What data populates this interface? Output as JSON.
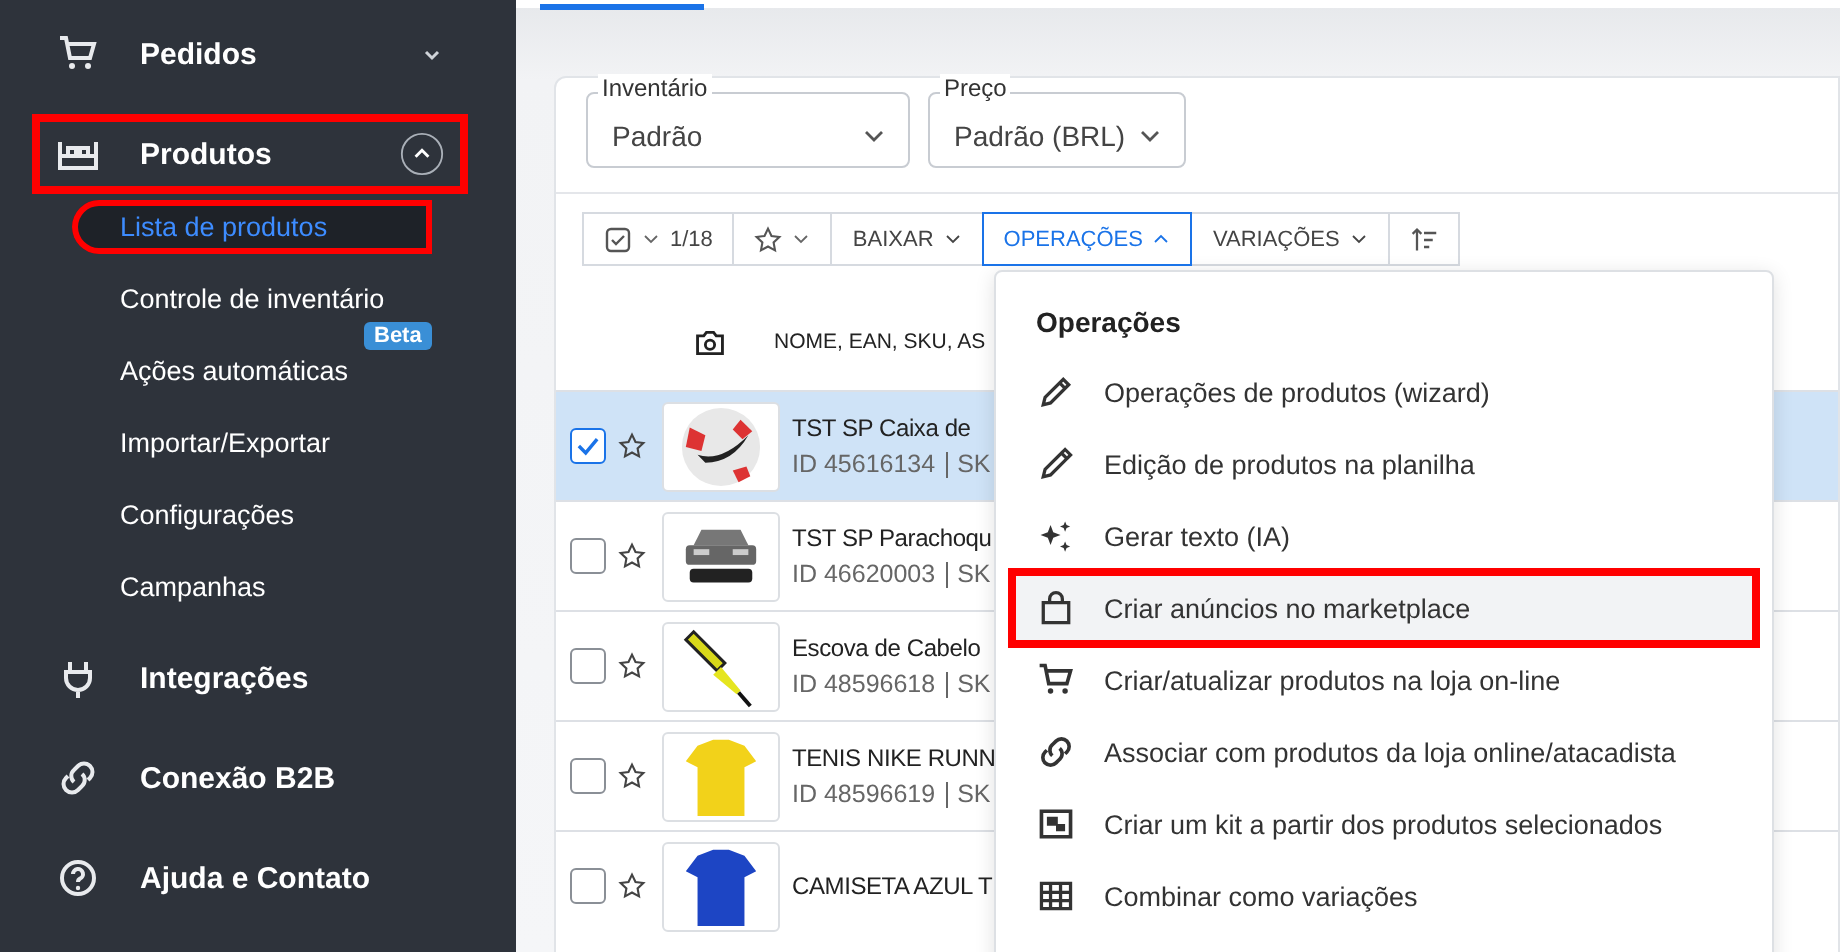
{
  "sidebar": {
    "items": [
      {
        "label": "Pedidos",
        "expanded": false,
        "annotated": false
      },
      {
        "label": "Produtos",
        "expanded": true,
        "annotated": true,
        "children": [
          {
            "label": "Lista de produtos",
            "selected": true,
            "annotated": true
          },
          {
            "label": "Controle de inventário",
            "selected": false,
            "annotated": false
          },
          {
            "label": "Ações automáticas",
            "selected": false,
            "annotated": false,
            "badge": "Beta"
          },
          {
            "label": "Importar/Exportar",
            "selected": false,
            "annotated": false
          },
          {
            "label": "Configurações",
            "selected": false,
            "annotated": false
          },
          {
            "label": "Campanhas",
            "selected": false,
            "annotated": false
          }
        ]
      },
      {
        "label": "Integrações",
        "annotated": false
      },
      {
        "label": "Conexão B2B",
        "annotated": false
      },
      {
        "label": "Ajuda e Contato",
        "annotated": false
      }
    ]
  },
  "filters": [
    {
      "label": "Inventário",
      "value": "Padrão"
    },
    {
      "label": "Preço",
      "value": "Padrão (BRL)"
    }
  ],
  "toolbar": {
    "count": "1/18",
    "buttons": [
      {
        "label": "BAIXAR",
        "selected": false
      },
      {
        "label": "OPERAÇÕES",
        "selected": true
      },
      {
        "label": "VARIAÇÕES",
        "selected": false
      }
    ]
  },
  "table": {
    "column": "NOME, EAN, SKU, AS",
    "rows": [
      {
        "selected": true,
        "checked": true,
        "starred": false,
        "name": "TST SP Caixa de",
        "id": "ID 45616134",
        "sku": "SK"
      },
      {
        "selected": false,
        "checked": false,
        "starred": false,
        "name": "TST SP Parachoqu",
        "id": "ID 46620003",
        "sku": "SK"
      },
      {
        "selected": false,
        "checked": false,
        "starred": false,
        "name": "Escova de Cabelo",
        "id": "ID 48596618",
        "sku": "SK"
      },
      {
        "selected": false,
        "checked": false,
        "starred": false,
        "name": "TENIS NIKE RUNN",
        "id": "ID 48596619",
        "sku": "SK"
      },
      {
        "selected": false,
        "checked": false,
        "starred": false,
        "name": "CAMISETA AZUL T"
      }
    ]
  },
  "menu": {
    "title": "Operações",
    "items": [
      {
        "label": "Operações de produtos (wizard)",
        "kind": "pencil",
        "annotated": false
      },
      {
        "label": "Edição de produtos na planilha",
        "kind": "pen",
        "annotated": false
      },
      {
        "label": "Gerar texto (IA)",
        "kind": "sparkle",
        "annotated": false
      },
      {
        "label": "Criar anúncios no marketplace",
        "kind": "bag",
        "annotated": true
      },
      {
        "label": "Criar/atualizar produtos na loja on-line",
        "kind": "cart",
        "annotated": false
      },
      {
        "label": "Associar com produtos da loja online/atacadista",
        "kind": "link",
        "annotated": false
      },
      {
        "label": "Criar um kit a partir dos produtos selecionados",
        "kind": "kit",
        "annotated": false
      },
      {
        "label": "Combinar como variações",
        "kind": "grid",
        "annotated": false
      }
    ]
  }
}
